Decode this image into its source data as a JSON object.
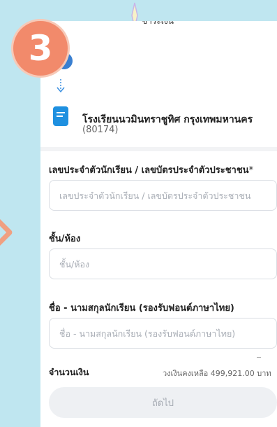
{
  "step_number": "3",
  "header": {
    "title": "ชำระเงิน"
  },
  "school": {
    "name": "โรงเรียนนวมินทราชูทิศ กรุงเทพมหานคร",
    "code": "(80174)"
  },
  "form": {
    "student_id": {
      "label": "เลขประจำตัวนักเรียน / เลขบัตรประจำตัวประชาชน",
      "required_mark": "*",
      "placeholder": "เลขประจำตัวนักเรียน / เลขบัตรประจำตัวประชาชน"
    },
    "class": {
      "label": "ชั้น/ห้อง",
      "placeholder": "ชั้น/ห้อง"
    },
    "student_name": {
      "label": "ชื่อ - นามสกุลนักเรียน (รองรับฟอนต์ภาษาไทย)",
      "placeholder": "ชื่อ - นามสกุลนักเรียน (รองรับฟอนต์ภาษาไทย)"
    },
    "amount_label": "จำนวนเงิน",
    "balance_text": "วงเงินคงเหลือ 499,921.00 บาท"
  },
  "next_button_label": "ถัดไป",
  "colors": {
    "background": "#bfe6f0",
    "badge": "#f28a6b",
    "school_icon": "#1e90e0",
    "button_bg": "#eef0f3"
  }
}
